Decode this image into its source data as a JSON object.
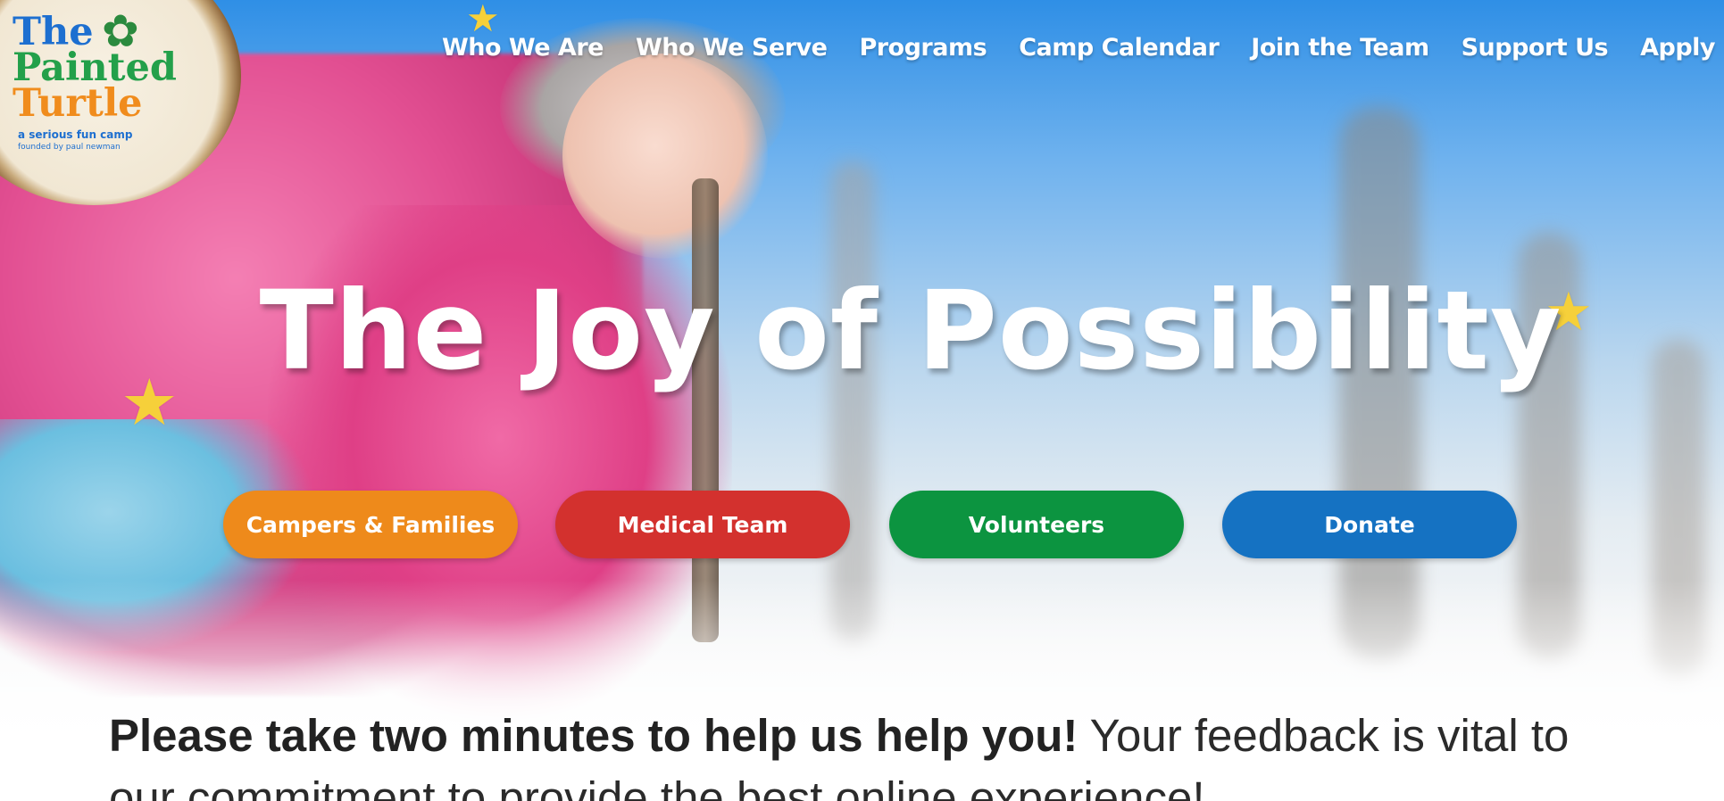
{
  "logo": {
    "line1": "The",
    "line2": "Painted",
    "line3": "Turtle",
    "tagline": "a serious fun camp",
    "subtag": "founded by paul newman"
  },
  "nav": {
    "items": [
      {
        "label": "Who We Are"
      },
      {
        "label": "Who We Serve"
      },
      {
        "label": "Programs"
      },
      {
        "label": "Camp Calendar"
      },
      {
        "label": "Join the Team"
      },
      {
        "label": "Support Us"
      },
      {
        "label": "Apply"
      }
    ]
  },
  "hero": {
    "title": "The Joy of Possibility"
  },
  "buttons": {
    "campers": "Campers & Families",
    "medical": "Medical Team",
    "volunteers": "Volunteers",
    "donate": "Donate"
  },
  "feedback": {
    "bold": "Please take two minutes to help us help you!",
    "rest": " Your feedback is vital to our commitment to provide the best online experience!"
  },
  "colors": {
    "campers": "#ee8a1b",
    "medical": "#d3312e",
    "volunteers": "#0c9440",
    "donate": "#1572c2",
    "star": "#f6d03a"
  }
}
